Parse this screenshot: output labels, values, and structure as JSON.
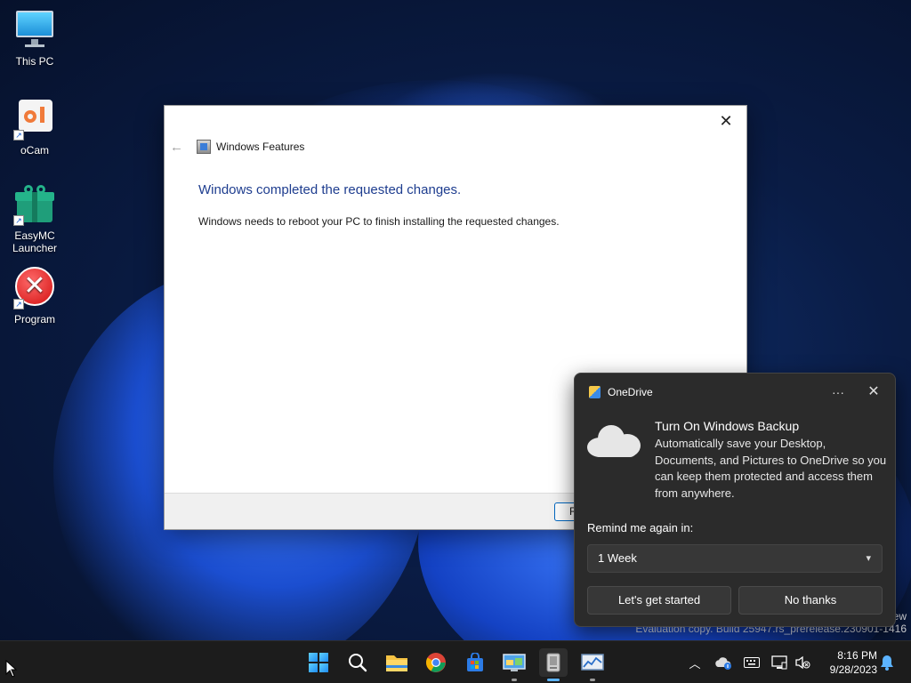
{
  "desktop": {
    "icons": [
      {
        "label": "This PC"
      },
      {
        "label": "oCam"
      },
      {
        "label": "EasyMC Launcher"
      },
      {
        "label": "Program"
      }
    ]
  },
  "dialog": {
    "title": "Windows Features",
    "heading": "Windows completed the requested changes.",
    "body": "Windows needs to reboot your PC to finish installing the requested changes.",
    "footer_button_label": "R"
  },
  "watermark": {
    "line1": "ew",
    "line2": "Evaluation copy. Build 25947.rs_prerelease.230901-1416"
  },
  "toast": {
    "app_name": "OneDrive",
    "title": "Turn On Windows Backup",
    "text": "Automatically save your Desktop, Documents, and Pictures to OneDrive so you can keep them protected and access them from anywhere.",
    "remind_label": "Remind me again in:",
    "remind_value": "1 Week",
    "primary_button": "Let's get started",
    "secondary_button": "No thanks",
    "more_glyph": "···",
    "close_glyph": "✕"
  },
  "taskbar": {
    "time": "8:16 PM",
    "date": "9/28/2023"
  },
  "colors": {
    "accent": "#0067c0",
    "heading": "#1e3d8f",
    "toast_bg": "#2b2b2b"
  }
}
